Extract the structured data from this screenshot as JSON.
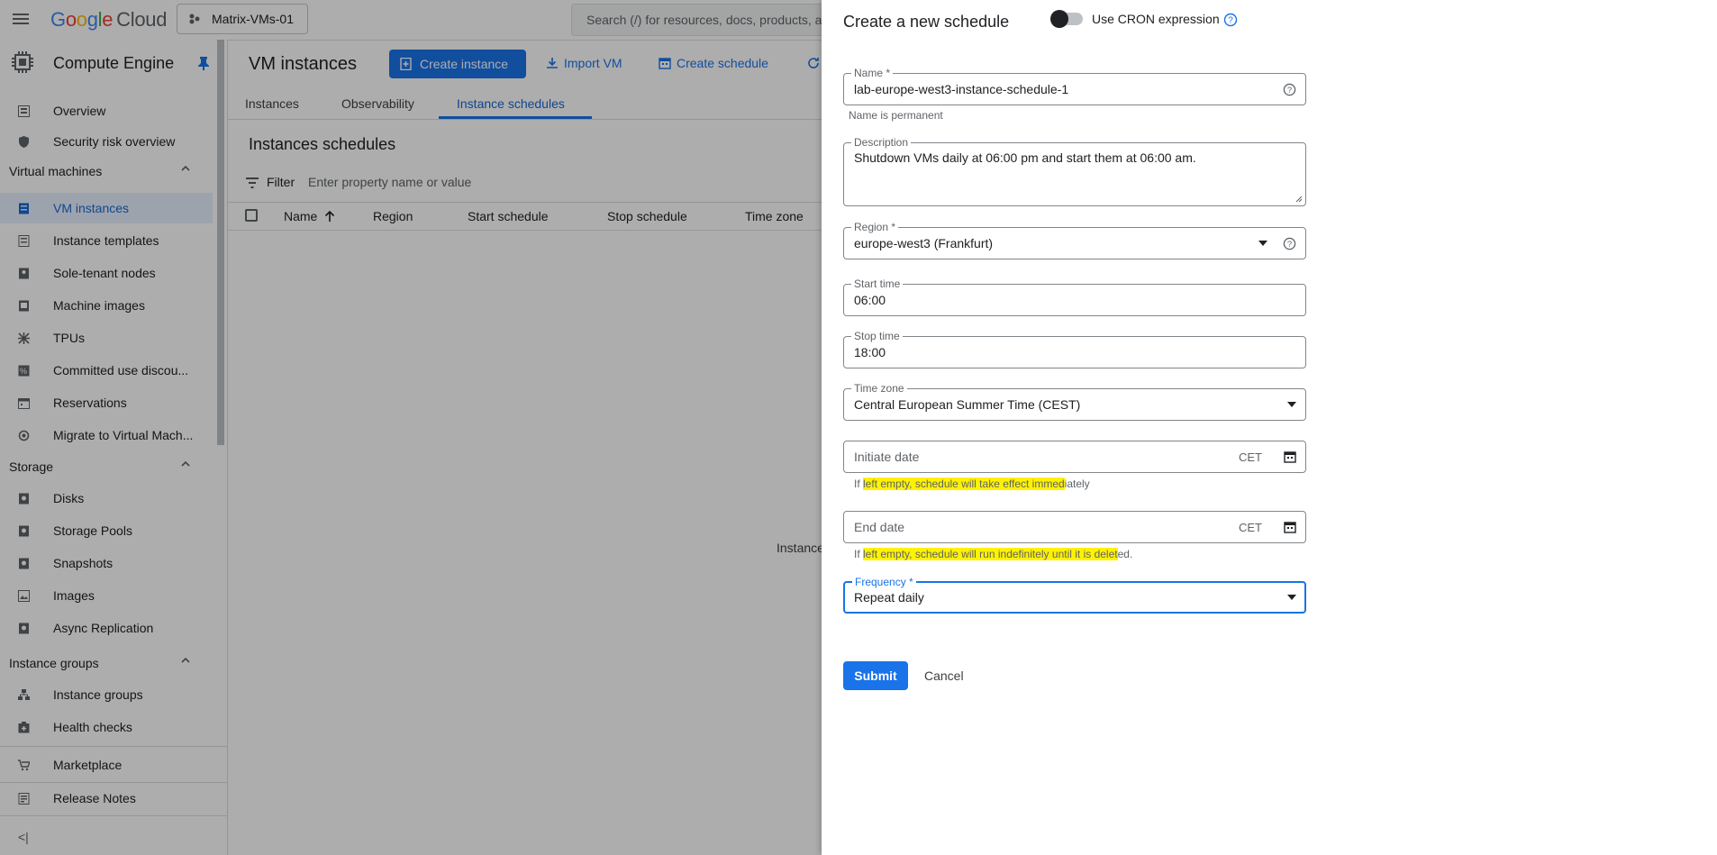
{
  "topbar": {
    "logo_google": [
      "G",
      "o",
      "o",
      "g",
      "l",
      "e"
    ],
    "logo_cloud": "Cloud",
    "project_name": "Matrix-VMs-01",
    "search_placeholder": "Search (/) for resources, docs, products, a"
  },
  "sidebar": {
    "title": "Compute Engine",
    "items": [
      {
        "label": "Overview"
      },
      {
        "label": "Security risk overview"
      },
      {
        "label": "VM instances"
      },
      {
        "label": "Instance templates"
      },
      {
        "label": "Sole-tenant nodes"
      },
      {
        "label": "Machine images"
      },
      {
        "label": "TPUs"
      },
      {
        "label": "Committed use discou..."
      },
      {
        "label": "Reservations"
      },
      {
        "label": "Migrate to Virtual Mach..."
      },
      {
        "label": "Disks"
      },
      {
        "label": "Storage Pools"
      },
      {
        "label": "Snapshots"
      },
      {
        "label": "Images"
      },
      {
        "label": "Async Replication"
      },
      {
        "label": "Instance groups"
      },
      {
        "label": "Health checks"
      },
      {
        "label": "Marketplace"
      },
      {
        "label": "Release Notes"
      }
    ],
    "sections": {
      "virtual_machines": "Virtual machines",
      "storage": "Storage",
      "instance_groups": "Instance groups"
    },
    "collapse_label": "<|"
  },
  "main": {
    "title": "VM instances",
    "create_instance": "Create instance",
    "import_vm": "Import VM",
    "create_schedule": "Create schedule",
    "tabs": [
      {
        "label": "Instances"
      },
      {
        "label": "Observability"
      },
      {
        "label": "Instance schedules"
      }
    ],
    "schedules_title": "Instances schedules",
    "filter_label": "Filter",
    "filter_placeholder": "Enter property name or value",
    "columns": [
      "Name",
      "Region",
      "Start schedule",
      "Stop schedule",
      "Time zone"
    ],
    "empty_text": "Instance"
  },
  "panel": {
    "title": "Create a new schedule",
    "cron_label": "Use CRON expression",
    "name": {
      "label": "Name *",
      "value": "lab-europe-west3-instance-schedule-1",
      "hint": "Name is permanent"
    },
    "description": {
      "label": "Description",
      "value": "Shutdown VMs daily at 06:00 pm and start them at 06:00 am."
    },
    "region": {
      "label": "Region *",
      "value": "europe-west3 (Frankfurt)"
    },
    "start_time": {
      "label": "Start time",
      "value": "06:00"
    },
    "stop_time": {
      "label": "Stop time",
      "value": "18:00"
    },
    "time_zone": {
      "label": "Time zone",
      "value": "Central European Summer Time (CEST)"
    },
    "initiate_date": {
      "placeholder": "Initiate date",
      "suffix": "CET",
      "hint_pre": "If ",
      "hint_hl": "left empty, schedule will take effect immed",
      "hint_post": "iately"
    },
    "end_date": {
      "placeholder": "End date",
      "suffix": "CET",
      "hint_pre": "If ",
      "hint_hl": "left empty, schedule will run indefinitely until it is delet",
      "hint_post": "ed."
    },
    "frequency": {
      "label": "Frequency *",
      "value": "Repeat daily"
    },
    "submit": "Submit",
    "cancel": "Cancel"
  },
  "colors": {
    "accent": "#1a73e8",
    "highlight": "#fff200"
  }
}
